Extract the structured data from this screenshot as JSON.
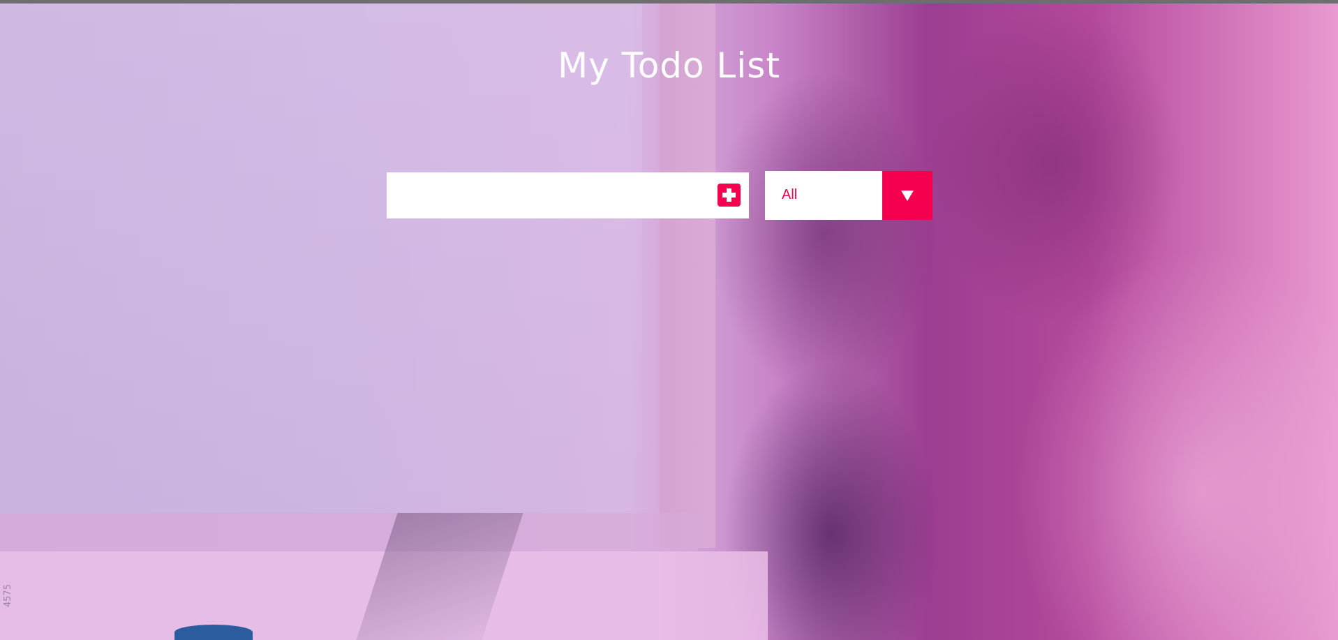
{
  "app": {
    "title": "My Todo List"
  },
  "todo_form": {
    "input_value": "",
    "input_placeholder": "",
    "add_icon": "plus-square-icon"
  },
  "filter": {
    "selected": "All",
    "options": [
      "All"
    ],
    "dropdown_icon": "caret-down-icon"
  },
  "background": {
    "watermark": "4575"
  },
  "colors": {
    "accent": "#f5004f",
    "title_text": "#ffffff",
    "overlay": "#c86ab9"
  }
}
